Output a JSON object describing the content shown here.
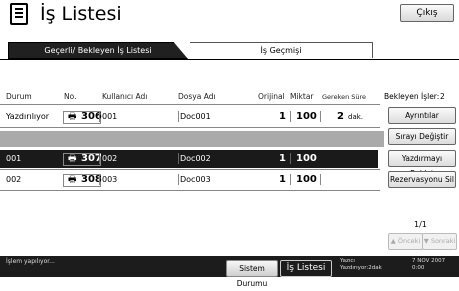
{
  "header": {
    "title": "İş Listesi",
    "exit_label": "Çıkış"
  },
  "tabs": [
    {
      "label": "Geçerli/ Bekleyen İş Listesi",
      "active": true
    },
    {
      "label": "İş Geçmişi",
      "active": false
    }
  ],
  "columns": {
    "status": "Durum",
    "no": "No.",
    "user": "Kullanıcı Adı",
    "doc": "Dosya Adı",
    "copies": "Orijinal",
    "qty": "Miktar",
    "remaining": "Gereken Süre"
  },
  "jobs": [
    {
      "status": "Yazdırılıyor",
      "no": "306",
      "user": "001",
      "doc": "Doc001",
      "copies": "1",
      "qty": "100",
      "remaining": "2",
      "remaining_unit": "dak.",
      "selected": false
    },
    {
      "status": "001",
      "no": "307",
      "user": "002",
      "doc": "Doc002",
      "copies": "1",
      "qty": "100",
      "remaining": "",
      "remaining_unit": "",
      "selected": true
    },
    {
      "status": "002",
      "no": "308",
      "user": "003",
      "doc": "Doc003",
      "copies": "1",
      "qty": "100",
      "remaining": "",
      "remaining_unit": "",
      "selected": false
    }
  ],
  "waiting": {
    "label": "Bekleyen İşler:",
    "count": "2"
  },
  "side_buttons": {
    "details": "Ayrıntılar",
    "change_order": "Sırayı Değiştir",
    "suspend": "Yazdırmayı Beklet",
    "delete_reservation": "Rezervasyonu Sil"
  },
  "pagination": {
    "indicator": "1/1",
    "prev": "Önceki",
    "next": "Sonraki"
  },
  "footer": {
    "status": "İşlem yapılıyor...",
    "system_status": "Sistem Durumu",
    "job_list": "İş Listesi",
    "printer_label_1": "Yazıcı",
    "printer_label_2": "Yazdırıyor:2dak",
    "date": "7 NOV 2007",
    "time": "0:00"
  }
}
